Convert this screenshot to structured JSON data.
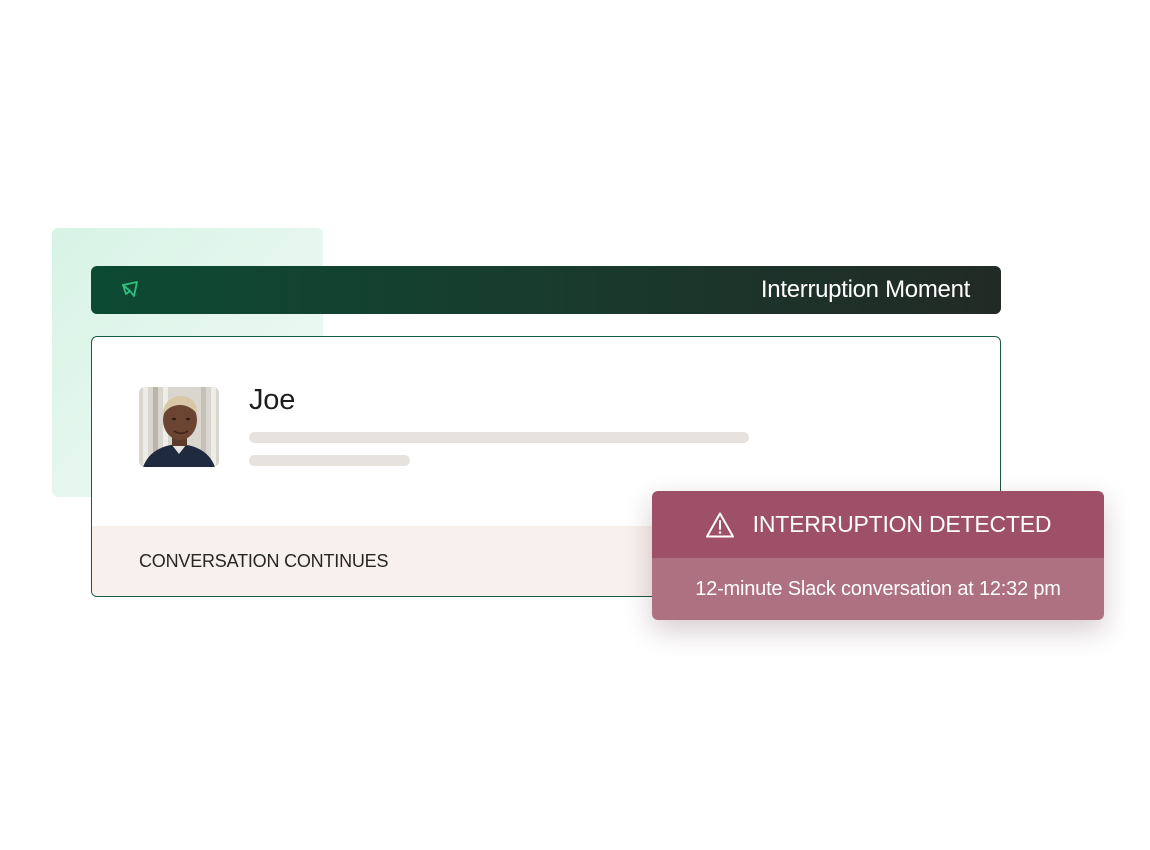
{
  "header": {
    "icon": "send-icon",
    "title": "Interruption Moment"
  },
  "card": {
    "avatar_icon": "avatar-photo",
    "person_name": "Joe",
    "footer_label": "CONVERSATION CONTINUES"
  },
  "alert": {
    "icon": "warning-triangle-icon",
    "title": "INTERRUPTION DETECTED",
    "detail": "12-minute Slack conversation at 12:32 pm"
  },
  "colors": {
    "header_start": "#0c4a33",
    "header_end": "#222a26",
    "card_border": "#1b5a42",
    "tint": "#d7f3e6",
    "footer_bg": "#f8f0ed",
    "alert_head": "#9d5068",
    "alert_body": "#ad7182",
    "icon_accent": "#2fbf7f"
  }
}
